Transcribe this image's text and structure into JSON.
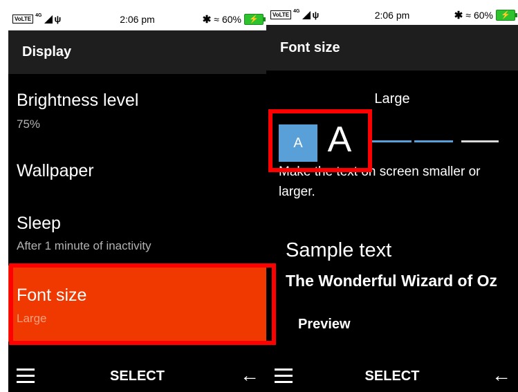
{
  "left": {
    "status": {
      "time": "2:06 pm",
      "battery": "60%",
      "volte": "VoLTE",
      "network": "4G"
    },
    "title": "Display",
    "items": [
      {
        "title": "Brightness level",
        "subtitle": "75%"
      },
      {
        "title": "Wallpaper",
        "subtitle": ""
      },
      {
        "title": "Sleep",
        "subtitle": "After 1 minute of inactivity"
      },
      {
        "title": "Font size",
        "subtitle": "Large"
      }
    ],
    "softkeys": {
      "center": "SELECT"
    }
  },
  "right": {
    "status": {
      "time": "2:06 pm",
      "battery": "60%",
      "volte": "VoLTE",
      "network": "4G"
    },
    "title": "Font size",
    "current": "Large",
    "small_glyph": "A",
    "large_glyph": "A",
    "hint": "Make the text on screen smaller or larger.",
    "sample_title": "Sample text",
    "sample_body": "The Wonderful Wizard of Oz",
    "preview": "Preview",
    "softkeys": {
      "center": "SELECT"
    },
    "slider_level": 3,
    "slider_steps": 4
  },
  "colors": {
    "highlight": "#f03900",
    "slider_active": "#5aa0d8",
    "slider_inactive": "#d9d9d9",
    "annotation": "#ff0000"
  }
}
